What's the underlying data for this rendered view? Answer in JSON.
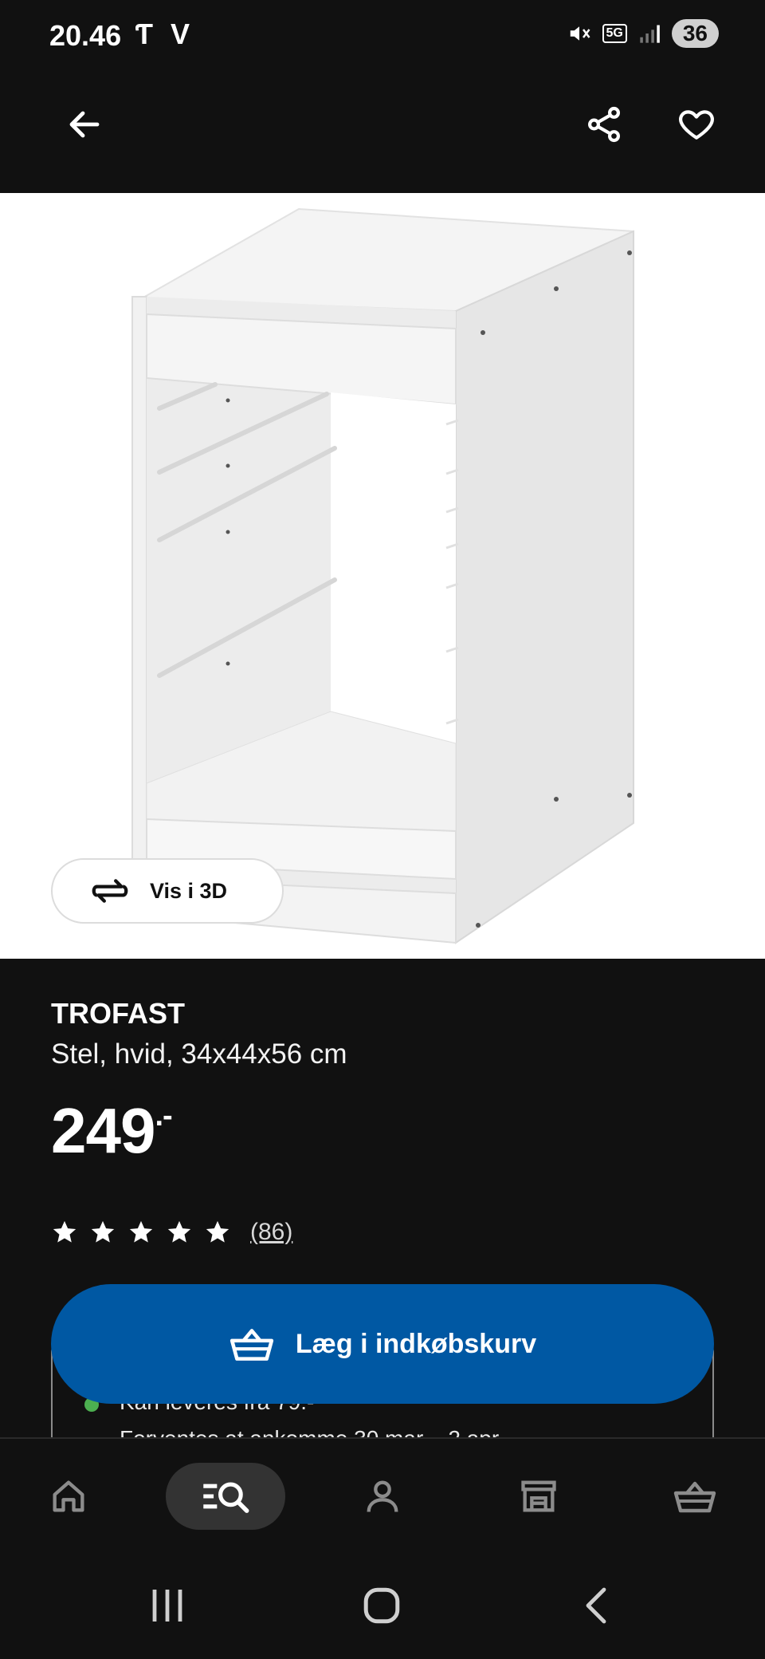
{
  "status_bar": {
    "time": "20.46",
    "network": "5G",
    "battery": "36"
  },
  "product": {
    "name": "TROFAST",
    "description": "Stel, hvid, 34x44x56 cm",
    "price_main": "249",
    "price_decimal": ".-",
    "rating_stars": 5,
    "review_count": "(86)"
  },
  "view_3d_label": "Vis i 3D",
  "delivery": {
    "line1": "Kan leveres fra 79.-",
    "line2": "Forventes at ankomme 30 mar. - 2 apr."
  },
  "add_to_cart_label": "Læg i indkøbskurv",
  "colors": {
    "accent": "#0058a3",
    "background": "#111111",
    "in_stock": "#4caf50"
  },
  "icons": [
    "back-arrow-icon",
    "share-icon",
    "heart-icon",
    "rotate-3d-icon",
    "star-icon",
    "basket-icon",
    "home-icon",
    "search-browse-icon",
    "profile-icon",
    "store-icon",
    "cart-icon"
  ]
}
